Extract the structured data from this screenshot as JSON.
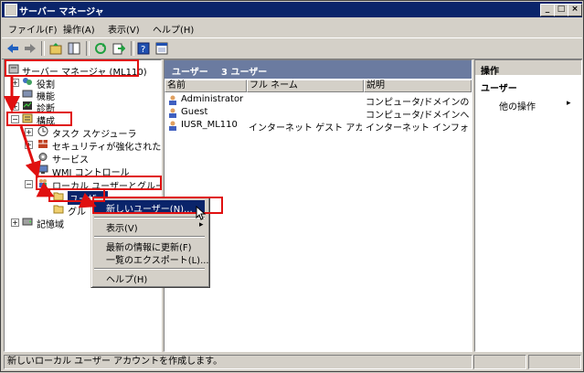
{
  "window": {
    "title": "サーバー マネージャ",
    "caption_buttons": [
      "_",
      "□",
      "×"
    ]
  },
  "menubar": {
    "items": [
      "ファイル(F)",
      "操作(A)",
      "表示(V)",
      "ヘルプ(H)"
    ]
  },
  "toolbar": {
    "icons": [
      "back-arrow-icon",
      "forward-arrow-icon",
      "up-folder-icon",
      "show-hide-tree-icon",
      "refresh-icon",
      "export-icon",
      "help-icon",
      "properties-icon"
    ]
  },
  "tree": {
    "root": "サーバー マネージャ (ML110)",
    "roles": "役割",
    "features": "機能",
    "diagnostics": "診断",
    "configuration": "構成",
    "task_scheduler": "タスク スケジューラ",
    "firewall": "セキュリティが強化された Wi",
    "services": "サービス",
    "wmi": "WMI コントロール",
    "local_users": "ローカル ユーザーとグループ",
    "users": "ユーザー",
    "groups": "グル",
    "storage": "記憶域"
  },
  "middle": {
    "title": "ユーザー",
    "count": "3 ユーザー",
    "columns": [
      "名前",
      "フル ネーム",
      "説明"
    ],
    "rows": [
      {
        "name": "Administrator",
        "full": "",
        "desc": "コンピュータ/ドメインの管理"
      },
      {
        "name": "Guest",
        "full": "",
        "desc": "コンピュータ/ドメインへのゲ"
      },
      {
        "name": "IUSR_ML110",
        "full": "インターネット ゲスト アカウン",
        "desc": "インターネット インフォメーシ"
      }
    ]
  },
  "actions": {
    "header": "操作",
    "section": "ユーザー",
    "other": "他の操作"
  },
  "context_menu": {
    "new_user": "新しいユーザー(N)...",
    "view": "表示(V)",
    "refresh": "最新の情報に更新(F)",
    "export": "一覧のエクスポート(L)...",
    "help": "ヘルプ(H)"
  },
  "status": {
    "text": "新しいローカル ユーザー アカウントを作成します。"
  },
  "colors": {
    "annotation": "#e01010",
    "title_bar": "#0a246a",
    "pane_header": "#6b7ba0",
    "selection": "#0a246a"
  }
}
